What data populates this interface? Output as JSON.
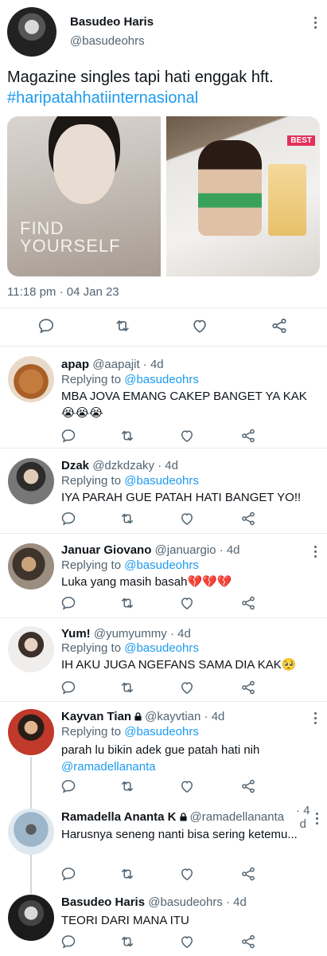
{
  "main_tweet": {
    "author_name": "Basudeo Haris",
    "author_handle": "@basudeohrs",
    "text": "Magazine singles tapi hati enggak hft.",
    "hashtag": "#haripatahhatiinternasional",
    "timestamp": "11:18 pm · 04 Jan 23",
    "media_left_text": "FIND YOURSELF",
    "media_right_badge": "BEST"
  },
  "replies": [
    {
      "name": "apap",
      "handle": "@aapajit",
      "age": "· 4d",
      "replying_prefix": "Replying to ",
      "replying_to": "@basudeohrs",
      "text": "MBA JOVA EMANG CAKEP BANGET YA KAK😭😭😭"
    },
    {
      "name": "Dzak",
      "handle": "@dzkdzaky",
      "age": "· 4d",
      "replying_prefix": "Replying to ",
      "replying_to": "@basudeohrs",
      "text": "IYA PARAH GUE PATAH HATI BANGET YO!!"
    },
    {
      "name": "Januar Giovano",
      "handle": "@januargio",
      "age": "· 4d",
      "replying_prefix": "Replying to ",
      "replying_to": "@basudeohrs",
      "text": "Luka yang masih basah💔💔💔"
    },
    {
      "name": "Yum!",
      "handle": "@yumyummy",
      "age": "· 4d",
      "replying_prefix": "Replying to ",
      "replying_to": "@basudeohrs",
      "text": "IH AKU JUGA NGEFANS SAMA DIA KAK🥺"
    },
    {
      "name": "Kayvan Tian",
      "handle": "@kayvtian",
      "age": "· 4d",
      "replying_prefix": "Replying to ",
      "replying_to": "@basudeohrs",
      "text": "parah lu bikin adek gue patah hati nih",
      "mention": "@ramadellananta"
    },
    {
      "name": "Ramadella Ananta K",
      "handle": "@ramadellananta",
      "age_line1": "· 4",
      "age_line2": "d",
      "text": "Harusnya seneng nanti bisa sering ketemu..."
    },
    {
      "name": "Basudeo Haris",
      "handle": "@basudeohrs",
      "age": "· 4d",
      "text": "TEORI DARI MANA ITU"
    }
  ],
  "icons": [
    "reply-icon",
    "retweet-icon",
    "like-icon",
    "share-icon",
    "more-icon",
    "lock-icon"
  ],
  "colors": {
    "link": "#1d9bf0",
    "muted": "#536471",
    "text": "#0f1419",
    "divider": "#e6ebef"
  }
}
